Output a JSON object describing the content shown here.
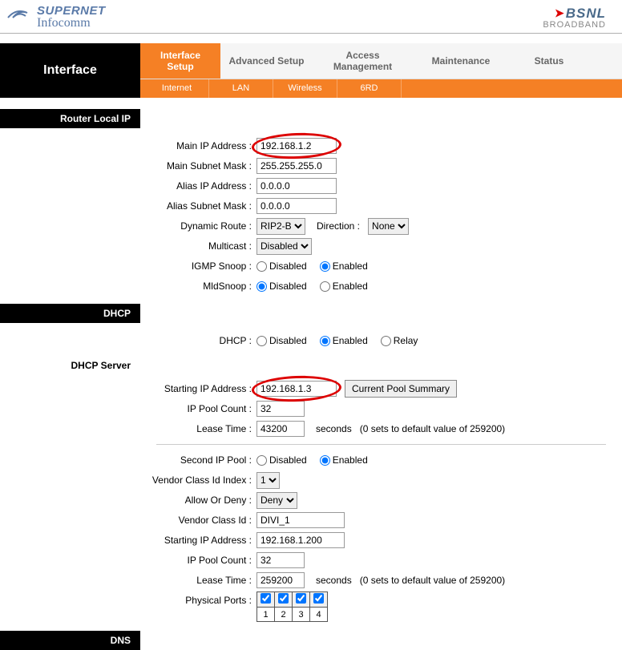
{
  "brand": {
    "name": "SUPERNET",
    "sub": "Infocomm",
    "isp": "BSNL",
    "isp_sub": "BROADBAND"
  },
  "page_title": "Interface",
  "tabs": {
    "main": [
      "Interface Setup",
      "Advanced Setup",
      "Access Management",
      "Maintenance",
      "Status"
    ],
    "active_main": 0,
    "sub": [
      "Internet",
      "LAN",
      "Wireless",
      "6RD"
    ],
    "active_sub": 1
  },
  "sections": {
    "router_local_ip": "Router Local IP",
    "dhcp": "DHCP",
    "dhcp_server": "DHCP Server",
    "dns": "DNS"
  },
  "labels": {
    "main_ip": "Main IP Address :",
    "main_subnet": "Main Subnet Mask :",
    "alias_ip": "Alias IP Address :",
    "alias_subnet": "Alias Subnet Mask :",
    "dynamic_route": "Dynamic Route :",
    "direction": "Direction :",
    "multicast": "Multicast :",
    "igmp_snoop": "IGMP Snoop :",
    "mld_snoop": "MldSnoop :",
    "dhcp": "DHCP :",
    "starting_ip": "Starting IP Address :",
    "ip_pool_count": "IP Pool Count :",
    "lease_time": "Lease Time :",
    "second_ip_pool": "Second IP Pool :",
    "vendor_idx": "Vendor Class Id Index :",
    "allow_deny": "Allow Or Deny :",
    "vendor_id": "Vendor Class Id :",
    "starting_ip2": "Starting IP Address :",
    "ip_pool_count2": "IP Pool Count :",
    "lease_time2": "Lease Time :",
    "physical_ports": "Physical Ports :",
    "seconds": "seconds",
    "lease_hint": "(0 sets to default value of 259200)",
    "disabled": "Disabled",
    "enabled": "Enabled",
    "relay": "Relay",
    "pool_summary": "Current Pool Summary"
  },
  "values": {
    "main_ip": "192.168.1.2",
    "main_subnet": "255.255.255.0",
    "alias_ip": "0.0.0.0",
    "alias_subnet": "0.0.0.0",
    "dynamic_route": "RIP2-B",
    "direction": "None",
    "multicast": "Disabled",
    "igmp_snoop": "enabled",
    "mld_snoop": "disabled",
    "dhcp_mode": "enabled",
    "pool1_start": "192.168.1.3",
    "pool1_count": "32",
    "pool1_lease": "43200",
    "second_pool": "enabled",
    "vendor_idx": "1",
    "allow_deny": "Deny",
    "vendor_id": "DIVI_1",
    "pool2_start": "192.168.1.200",
    "pool2_count": "32",
    "pool2_lease": "259200",
    "ports": [
      true,
      true,
      true,
      true
    ],
    "port_nums": [
      "1",
      "2",
      "3",
      "4"
    ]
  }
}
